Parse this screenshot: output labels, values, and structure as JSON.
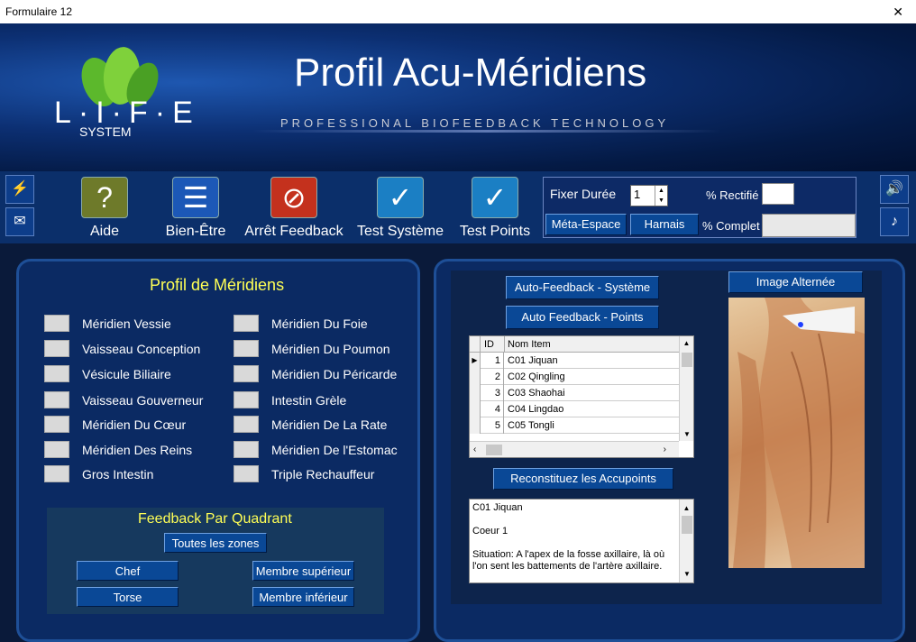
{
  "window": {
    "title": "Formulaire 12",
    "close_glyph": "✕"
  },
  "banner": {
    "title": "Profil Acu-Méridiens",
    "tagline": "PROFESSIONAL BIOFEEDBACK TECHNOLOGY",
    "logo_text": "L·I·F·E",
    "logo_sub": "SYSTEM"
  },
  "toolbar": {
    "buttons": [
      {
        "label": "Aide",
        "icon": "question-icon",
        "glyph": "?"
      },
      {
        "label": "Bien-Être",
        "icon": "document-icon",
        "glyph": "☰"
      },
      {
        "label": "Arrêt Feedback",
        "icon": "stop-icon",
        "glyph": "⊘"
      },
      {
        "label": "Test Système",
        "icon": "checkbox-icon",
        "glyph": "✓"
      },
      {
        "label": "Test Points",
        "icon": "checkbox-icon",
        "glyph": "✓"
      }
    ],
    "fixer_duree_label": "Fixer Durée",
    "fixer_duree_value": "1",
    "rectifie_label": "% Rectifié",
    "complet_label": "% Complet",
    "meta_espace": "Méta-Espace",
    "harnais": "Harnais"
  },
  "meridiens": {
    "title": "Profil de Méridiens",
    "left": [
      "Méridien Vessie",
      "Vaisseau Conception",
      "Vésicule Biliaire",
      "Vaisseau Gouverneur",
      "Méridien Du Cœur",
      "Méridien Des Reins",
      "Gros Intestin"
    ],
    "right": [
      "Méridien Du Foie",
      "Méridien Du Poumon",
      "Méridien Du Péricarde",
      "Intestin Grèle",
      "Méridien De La Rate",
      "Méridien De l'Estomac",
      "Triple Rechauffeur"
    ]
  },
  "quadrant": {
    "title": "Feedback Par Quadrant",
    "toutes": "Toutes les zones",
    "chef": "Chef",
    "torse": "Torse",
    "membre_sup": "Membre supérieur",
    "membre_inf": "Membre inférieur"
  },
  "right_panel": {
    "auto_systeme": "Auto-Feedback - Système",
    "auto_points": "Auto Feedback - Points",
    "image_alt": "Image Alternée",
    "reconstituez": "Reconstituez les Accupoints",
    "grid": {
      "col_id": "ID",
      "col_name": "Nom Item",
      "rows": [
        {
          "id": "1",
          "name": "C01 Jiquan"
        },
        {
          "id": "2",
          "name": "C02 Qingling"
        },
        {
          "id": "3",
          "name": "C03 Shaohai"
        },
        {
          "id": "4",
          "name": "C04 Lingdao"
        },
        {
          "id": "5",
          "name": "C05 Tongli"
        }
      ]
    },
    "detail": {
      "line1": "C01 Jiquan",
      "line2": "Coeur 1",
      "line3": "Situation: A l'apex de la fosse axillaire, là où l'on sent les battements de l'artère axillaire."
    }
  }
}
